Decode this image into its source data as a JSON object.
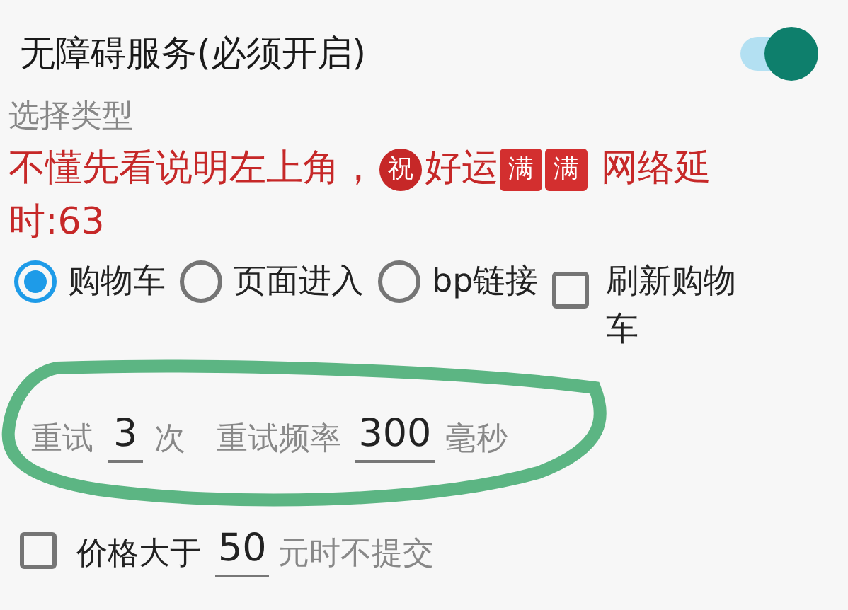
{
  "service": {
    "label": "无障碍服务(必须开启)",
    "on": true
  },
  "type_label": "选择类型",
  "notice": [
    [
      {
        "kind": "text",
        "text": "不懂先看说明左上角，"
      },
      {
        "kind": "circle-badge",
        "text": "祝"
      },
      {
        "kind": "text",
        "text": "好运"
      },
      {
        "kind": "square-badge",
        "text": "满"
      },
      {
        "kind": "square-badge",
        "text": "满"
      },
      {
        "kind": "text",
        "text": " 网络延"
      }
    ],
    [
      {
        "kind": "text",
        "text": "时:63"
      }
    ]
  ],
  "options": [
    {
      "kind": "radio",
      "label": "购物车",
      "selected": true
    },
    {
      "kind": "radio",
      "label": "页面进入",
      "selected": false
    },
    {
      "kind": "radio",
      "label": "bp链接",
      "selected": false
    },
    {
      "kind": "checkbox",
      "label": "刷新购物车",
      "checked": false
    }
  ],
  "retry": {
    "label": "重试",
    "count": "3",
    "count_unit": "次",
    "rate_label": "重试频率",
    "rate": "300",
    "rate_unit": "毫秒"
  },
  "price": {
    "checked": false,
    "label": "价格大于",
    "value": "50",
    "suffix": "元时不提交"
  }
}
